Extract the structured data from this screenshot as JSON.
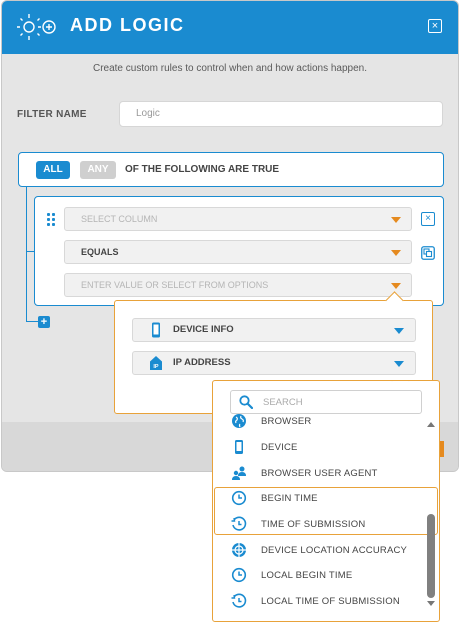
{
  "header": {
    "title": "ADD LOGIC",
    "close": "×"
  },
  "subtitle": "Create custom rules to control when and how actions happen.",
  "filter_name": {
    "label": "FILTER NAME",
    "placeholder": "Logic"
  },
  "conditions": {
    "all_label": "ALL",
    "any_label": "ANY",
    "text": "OF THE FOLLOWING ARE TRUE",
    "add": "+"
  },
  "rule": {
    "select_column": "SELECT COLUMN",
    "operator": "EQUALS",
    "value_placeholder": "ENTER VALUE OR SELECT FROM OPTIONS",
    "remove": "×"
  },
  "options": {
    "device_info": "DEVICE INFO",
    "ip_address": "IP ADDRESS"
  },
  "dropdown": {
    "search_placeholder": "SEARCH",
    "items": [
      {
        "label": "BROWSER",
        "icon": "globe-icon"
      },
      {
        "label": "DEVICE",
        "icon": "phone-icon"
      },
      {
        "label": "BROWSER USER AGENT",
        "icon": "users-icon"
      },
      {
        "label": "BEGIN TIME",
        "icon": "clock-icon"
      },
      {
        "label": "TIME OF SUBMISSION",
        "icon": "clock-history-icon"
      },
      {
        "label": "DEVICE LOCATION ACCURACY",
        "icon": "crosshair-icon"
      },
      {
        "label": "LOCAL BEGIN TIME",
        "icon": "clock-icon"
      },
      {
        "label": "LOCAL TIME OF SUBMISSION",
        "icon": "clock-history-icon"
      }
    ]
  },
  "colors": {
    "primary": "#1a8bd0",
    "accent": "#e58a1f"
  }
}
